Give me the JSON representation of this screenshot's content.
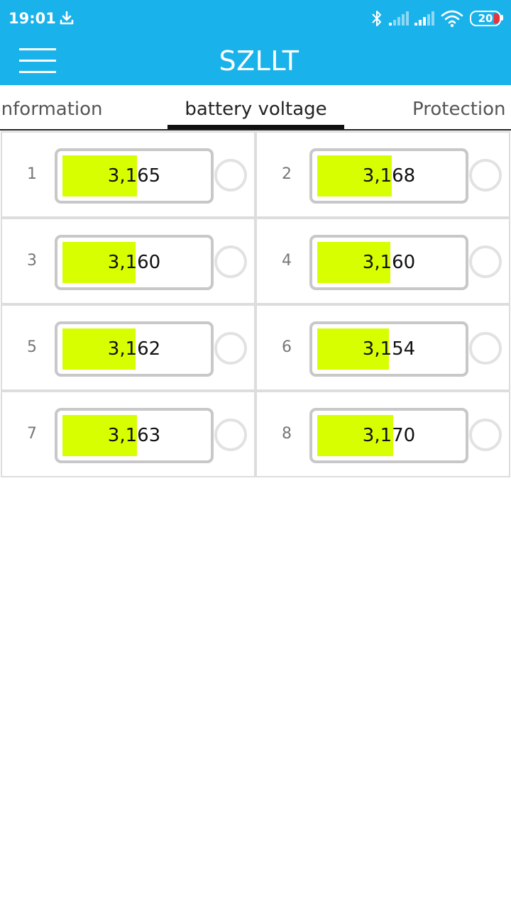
{
  "status_bar": {
    "time": "19:01",
    "battery_level": "20",
    "icons": [
      "download-icon",
      "bluetooth-icon",
      "signal-icon",
      "signal-icon",
      "wifi-icon",
      "battery-icon"
    ]
  },
  "app_bar": {
    "title": "SZLLT",
    "menu_icon": "hamburger-menu-icon"
  },
  "tabs": [
    {
      "label": "Information",
      "selected": false
    },
    {
      "label": "battery voltage",
      "selected": true
    },
    {
      "label": "Protection d",
      "selected": false
    }
  ],
  "cells": [
    {
      "index": "1",
      "value": "3,165",
      "fill": 0.52
    },
    {
      "index": "2",
      "value": "3,168",
      "fill": 0.52
    },
    {
      "index": "3",
      "value": "3,160",
      "fill": 0.51
    },
    {
      "index": "4",
      "value": "3,160",
      "fill": 0.51
    },
    {
      "index": "5",
      "value": "3,162",
      "fill": 0.51
    },
    {
      "index": "6",
      "value": "3,154",
      "fill": 0.5
    },
    {
      "index": "7",
      "value": "3,163",
      "fill": 0.52
    },
    {
      "index": "8",
      "value": "3,170",
      "fill": 0.53
    }
  ],
  "colors": {
    "primary": "#1AB2EA",
    "battery_fill": "#D8FF00",
    "border": "#DDDDDD",
    "battery_border": "#C8C8C8",
    "indicator": "#E2E2E2"
  }
}
